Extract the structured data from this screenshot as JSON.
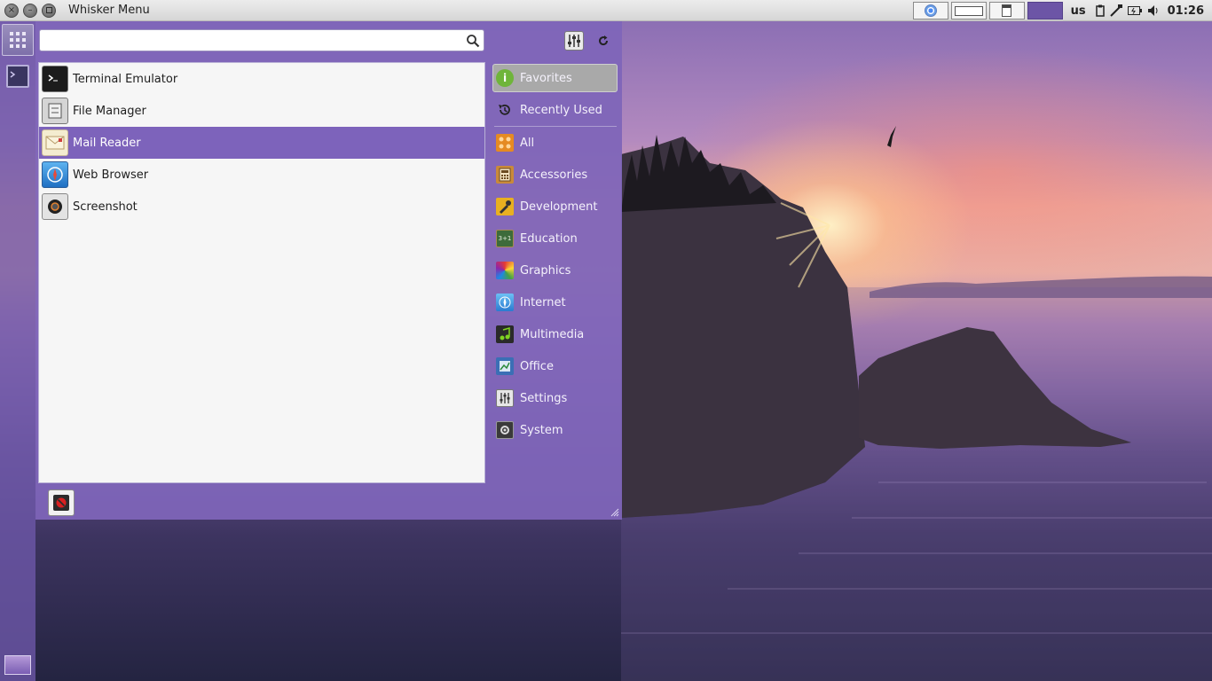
{
  "window": {
    "title": "Whisker Menu"
  },
  "panel": {
    "keyboard_layout": "us",
    "clock": "01:26",
    "tray_icons": [
      "clipboard-icon",
      "network-wired-icon",
      "battery-icon",
      "volume-icon"
    ]
  },
  "search": {
    "value": "",
    "placeholder": ""
  },
  "apps": [
    {
      "label": "Terminal Emulator",
      "icon": "terminal-icon"
    },
    {
      "label": "File Manager",
      "icon": "file-manager-icon"
    },
    {
      "label": "Mail Reader",
      "icon": "mail-icon"
    },
    {
      "label": "Web Browser",
      "icon": "web-browser-icon"
    },
    {
      "label": "Screenshot",
      "icon": "camera-icon"
    }
  ],
  "categories": [
    {
      "label": "Favorites",
      "icon": "favorites-icon"
    },
    {
      "label": "Recently Used",
      "icon": "history-icon"
    },
    {
      "label": "All",
      "icon": "all-icon"
    },
    {
      "label": "Accessories",
      "icon": "accessories-icon"
    },
    {
      "label": "Development",
      "icon": "development-icon"
    },
    {
      "label": "Education",
      "icon": "education-icon"
    },
    {
      "label": "Graphics",
      "icon": "graphics-icon"
    },
    {
      "label": "Internet",
      "icon": "internet-icon"
    },
    {
      "label": "Multimedia",
      "icon": "multimedia-icon"
    },
    {
      "label": "Office",
      "icon": "office-icon"
    },
    {
      "label": "Settings",
      "icon": "settings-icon"
    },
    {
      "label": "System",
      "icon": "system-icon"
    }
  ],
  "selected": {
    "app": "Mail Reader",
    "category": "Favorites"
  },
  "colors": {
    "accent": "#7d63bb",
    "menu_background": "#7e65b9",
    "panel_background": "#e0e0e0",
    "list_background": "#f6f6f6"
  }
}
